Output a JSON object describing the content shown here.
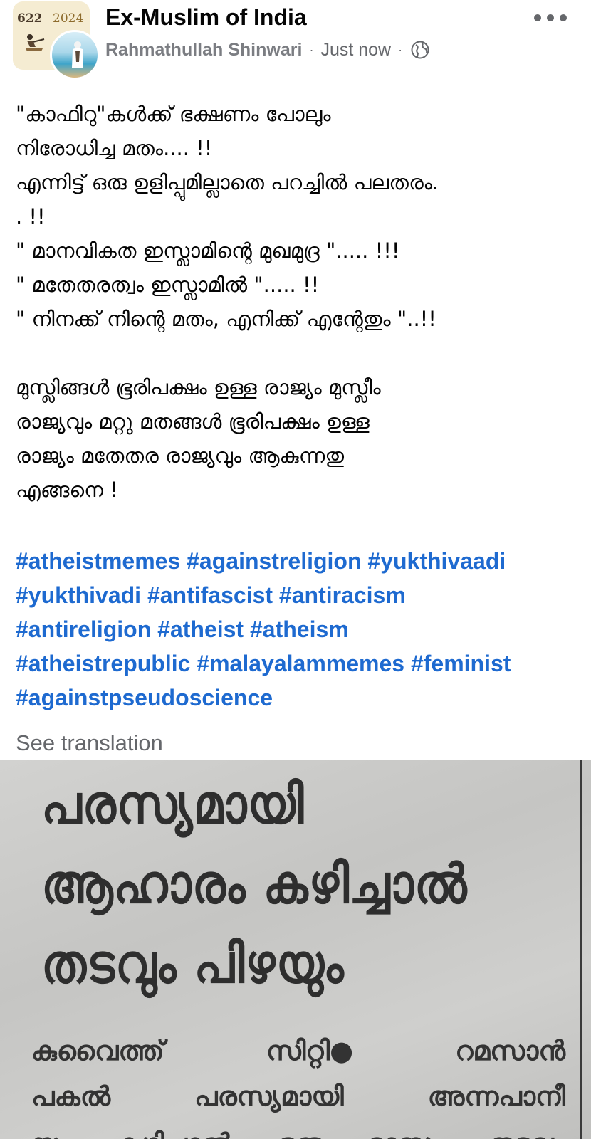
{
  "header": {
    "group_name": "Ex-Muslim of India",
    "author": "Rahmathullah Shinwari",
    "timestamp": "Just now",
    "privacy_icon": "globe-icon",
    "more_icon": "more-horizontal-icon",
    "group_avatar_text_left": "622",
    "group_avatar_text_right": "2024"
  },
  "post": {
    "lines": [
      "\"കാഫിറു\"കൾക്ക്  ഭക്ഷണം പോലും",
      "നിരോധിച്ച മതം.... !!",
      "എന്നിട്ട് ഒരു ഉളിപ്പുമില്ലാതെ പറച്ചിൽ പലതരം.",
      ". !!",
      "\" മാനവികത ഇസ്ലാമിന്റെ മുഖമുദ്ര \"..... !!!",
      "\" മതേതരത്വം ഇസ്ലാമിൽ \"..... !!",
      "\" നിനക്ക് നിന്റെ മതം, എനിക്ക് എന്റേതും \"..!!"
    ],
    "paragraph2": [
      " മുസ്ലിങ്ങൾ ഭൂരിപക്ഷം ഉള്ള രാജ്യം മുസ്ലീം",
      "രാജ്യവും മറ്റു മതങ്ങൾ ഭൂരിപക്ഷം ഉള്ള",
      "രാജ്യം മതേതര രാജ്യവും ആകുന്നതു",
      "എങ്ങനെ !"
    ],
    "hashtag_lines": [
      "#atheistmemes #againstreligion #yukthivaadi",
      "#yukthivadi #antifascist #antiracism",
      "#antireligion #atheist #atheism",
      "#atheistrepublic #malayalammemes #feminist",
      "#againstpseudoscience"
    ],
    "see_translation": "See translation",
    "link_color": "#1e6ad0"
  },
  "image": {
    "headline_lines": [
      "പരസ്യമായി",
      "ആഹാരം കഴിച്ചാൽ",
      "തടവും പിഴയും"
    ],
    "body_lines": [
      [
        "കുവൈത്ത്",
        "സിറ്റി●",
        "റമസാൻ"
      ],
      [
        "പകൽ",
        "പരസ്യമായി",
        "അന്നപാനീ"
      ],
      [
        "യം",
        "കഴിച്ചാൽ",
        "ഒരു",
        "മാസം",
        "തടവും"
      ]
    ]
  }
}
